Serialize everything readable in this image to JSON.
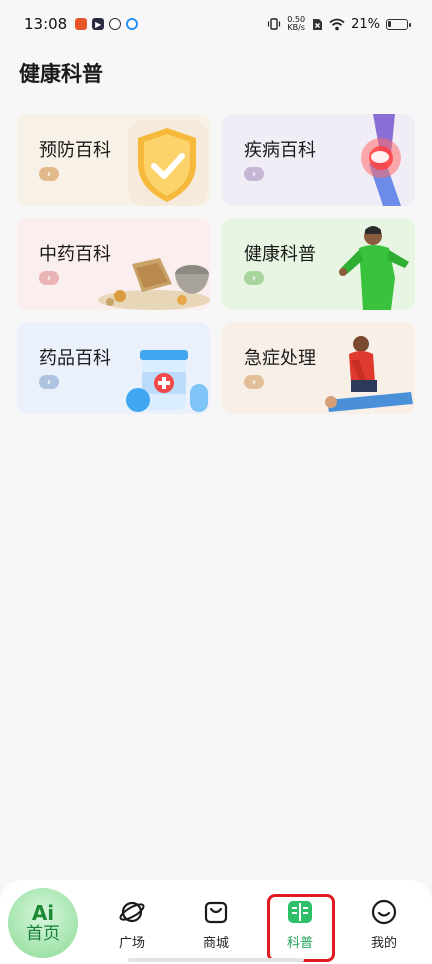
{
  "status_bar": {
    "time": "13:08",
    "net_speed_value": "0.50",
    "net_speed_unit": "KB/s",
    "battery_percent": "21%",
    "battery_level": 0.21
  },
  "page": {
    "title": "健康科普"
  },
  "cards": [
    {
      "label": "预防百科",
      "bg": "#f8f1e8",
      "arrow_color": "#e2b98a"
    },
    {
      "label": "疾病百科",
      "bg": "#f1edf6",
      "arrow_color": "#c5b6d6"
    },
    {
      "label": "中药百科",
      "bg": "#fbeeee",
      "arrow_color": "#eab4b4"
    },
    {
      "label": "健康科普",
      "bg": "#e7f5e2",
      "arrow_color": "#a8d59d"
    },
    {
      "label": "药品百科",
      "bg": "#eaf1fb",
      "arrow_color": "#aec3e0"
    },
    {
      "label": "急症处理",
      "bg": "#f8f0e8",
      "arrow_color": "#e2bf98"
    }
  ],
  "bottom_nav": {
    "home": {
      "badge": "Ai",
      "label": "首页"
    },
    "items": [
      {
        "label": "广场",
        "icon": "planet-icon"
      },
      {
        "label": "商城",
        "icon": "shopping-bag-icon"
      },
      {
        "label": "科普",
        "icon": "book-icon",
        "active": true
      },
      {
        "label": "我的",
        "icon": "smile-icon"
      }
    ]
  },
  "colors": {
    "accent": "#22a35a",
    "highlight": "#e01a22"
  }
}
